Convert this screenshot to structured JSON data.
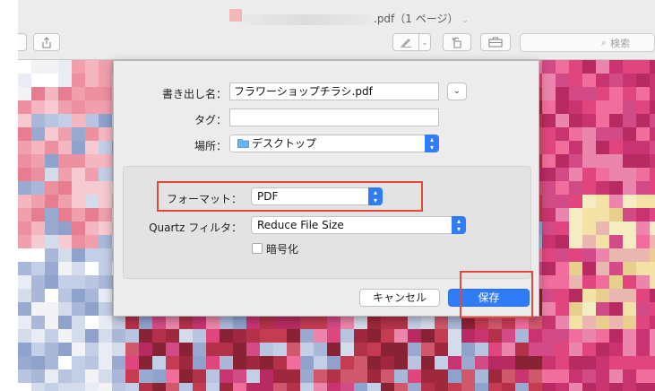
{
  "window": {
    "title": ".pdf（1 ページ）",
    "search_placeholder": "検索"
  },
  "dialog": {
    "filename_label": "書き出し名：",
    "filename_value": "フラワーショップチラシ.pdf",
    "tags_label": "タグ：",
    "tags_value": "",
    "location_label": "場所：",
    "location_value": "デスクトップ",
    "format_label": "フォーマット：",
    "format_value": "PDF",
    "quartz_label": "Quartz フィルタ：",
    "quartz_value": "Reduce File Size",
    "encrypt_label": "暗号化",
    "encrypt_checked": false,
    "cancel_label": "キャンセル",
    "save_label": "保存"
  },
  "colors": {
    "accent": "#2f7cf6",
    "highlight": "#e2493a"
  }
}
